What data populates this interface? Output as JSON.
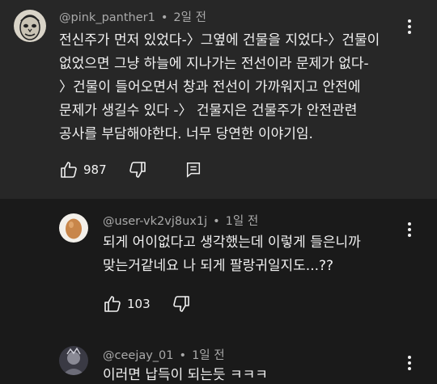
{
  "comments": [
    {
      "username": "@pink_panther1",
      "time": "2일 전",
      "lines": [
        "전신주가 먼저 있었다-〉그옆에 건물을 지었다-〉건물이",
        "없었으면 그냥 하늘에 지나가는 전선이라 문제가 없다-",
        "〉건물이 들어오면서 창과 전선이 가까워지고 안전에",
        "문제가 생길수 있다 -〉 건물지은 건물주가 안전관련",
        "공사를 부담해야한다. 너무 당연한 이야기임."
      ],
      "likes": "987",
      "icons": [
        "thumbs-up-icon",
        "thumbs-down-icon",
        "reply-icon",
        "more-vert-icon"
      ]
    },
    {
      "username": "@user-vk2vj8ux1j",
      "time": "1일 전",
      "lines": [
        "되게 어이없다고 생각했는데 이렇게 들은니까",
        "맞는거같네요 나 되게 팔랑귀일지도...??"
      ],
      "likes": "103"
    },
    {
      "username": "@ceejay_01",
      "time": "1일 전",
      "lines": [
        "이러면 납득이 되는듯 ㅋㅋㅋ"
      ]
    }
  ],
  "colors": {
    "top_bg": "#272727",
    "reply_bg": "#1a1a1a",
    "text": "#f1f1f1",
    "meta": "#aaaaaa"
  }
}
